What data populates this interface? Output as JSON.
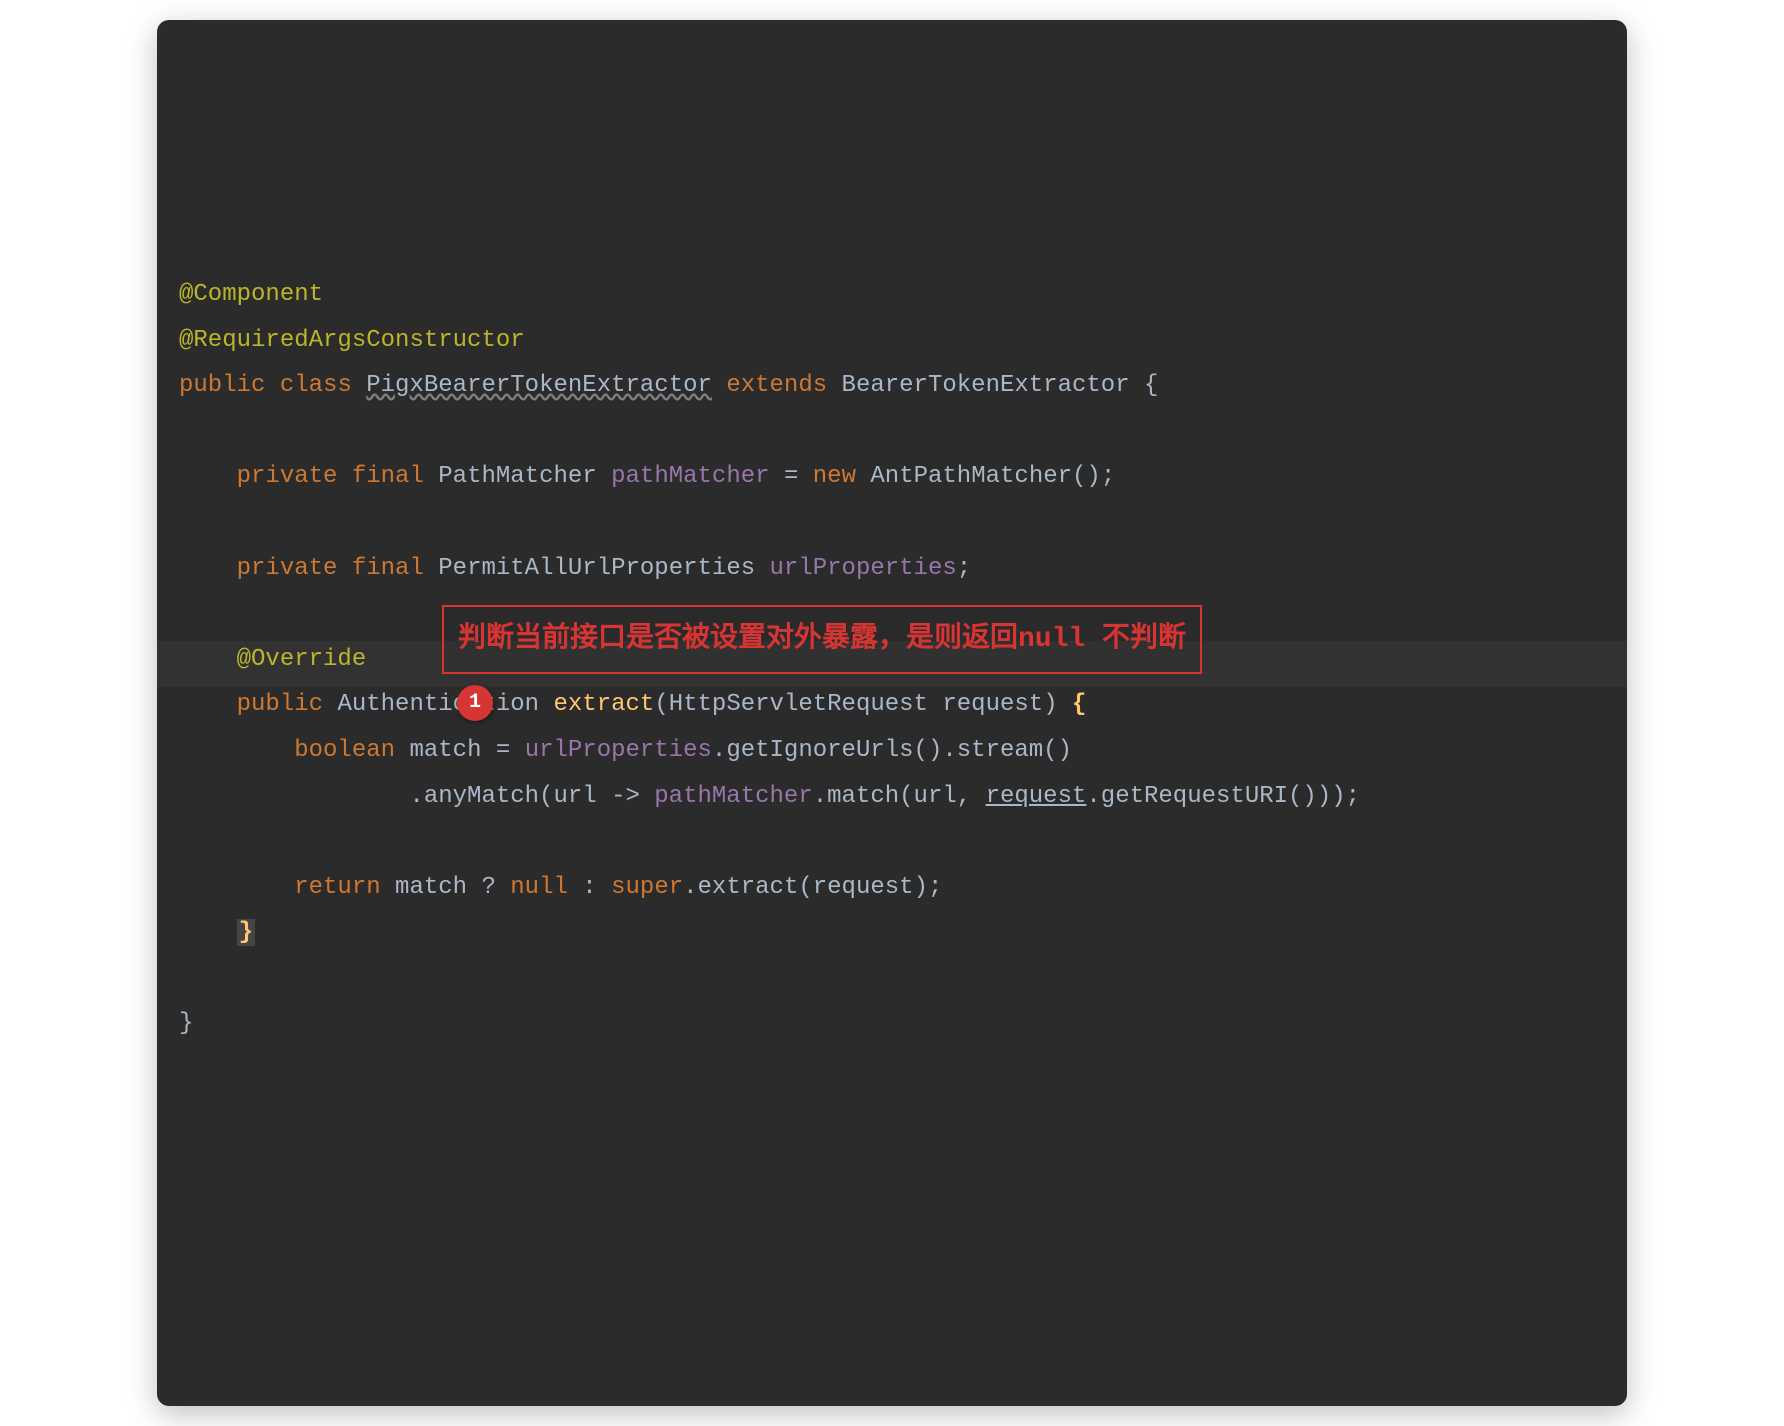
{
  "code": {
    "line1": "@Component",
    "line2": "@RequiredArgsConstructor",
    "line3": {
      "kw_public": "public",
      "kw_class": "class",
      "class_name": "PigxBearerTokenExtractor",
      "kw_extends": "extends",
      "parent_class": "BearerTokenExtractor",
      "brace": "{"
    },
    "line5": {
      "kw_private": "private",
      "kw_final": "final",
      "type": "PathMatcher",
      "field": "pathMatcher",
      "eq": "=",
      "kw_new": "new",
      "ctor": "AntPathMatcher",
      "end": "();"
    },
    "line7": {
      "kw_private": "private",
      "kw_final": "final",
      "type": "PermitAllUrlProperties",
      "field": "urlProperties",
      "end": ";"
    },
    "line9": "@Override",
    "line10": {
      "kw_public": "public",
      "ret_type": "Authentication",
      "method": "extract",
      "param_type": "HttpServletRequest",
      "param_name": "request",
      "brace": "{"
    },
    "line11": {
      "kw_boolean": "boolean",
      "var": "match",
      "eq": "=",
      "field": "urlProperties",
      "call1": ".getIgnoreUrls().stream()"
    },
    "line12": {
      "call": ".anyMatch(url ->",
      "field": "pathMatcher",
      "call2": ".match(url,",
      "param": "request",
      "call3": ".getRequestURI()));"
    },
    "line14": {
      "kw_return": "return",
      "var": "match",
      "ternary": "?",
      "kw_null": "null",
      "colon": ":",
      "kw_super": "super",
      "call": ".extract(request);"
    },
    "line15_brace": "}",
    "line17_brace": "}"
  },
  "annotation": {
    "text": "判断当前接口是否被设置对外暴露，是则返回null 不判断",
    "badge": "1"
  }
}
